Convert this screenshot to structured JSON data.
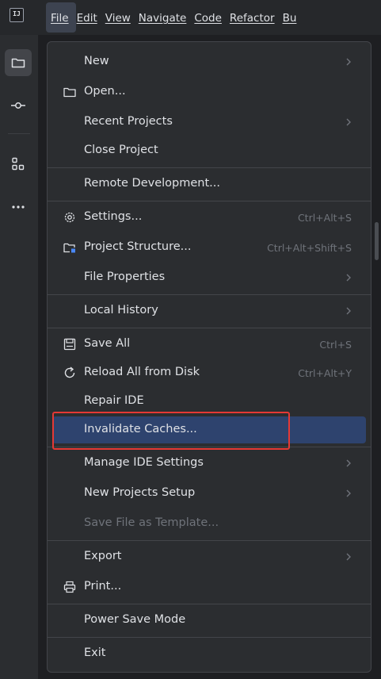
{
  "menubar": {
    "logo": "IJ",
    "items": [
      "File",
      "Edit",
      "View",
      "Navigate",
      "Code",
      "Refactor",
      "Bu"
    ]
  },
  "sidebar_icons": [
    "folder-icon",
    "commit-icon",
    "structure-icon",
    "more-icon"
  ],
  "file_menu": {
    "items": [
      {
        "label": "New",
        "submenu": true
      },
      {
        "label": "Open...",
        "icon": "folder-icon"
      },
      {
        "label": "Recent Projects",
        "submenu": true
      },
      {
        "label": "Close Project"
      },
      {
        "label": "Remote Development..."
      },
      {
        "label": "Settings...",
        "icon": "gear-icon",
        "shortcut": "Ctrl+Alt+S"
      },
      {
        "label": "Project Structure...",
        "icon": "project-structure-icon",
        "shortcut": "Ctrl+Alt+Shift+S"
      },
      {
        "label": "File Properties",
        "submenu": true
      },
      {
        "label": "Local History",
        "submenu": true
      },
      {
        "label": "Save All",
        "icon": "save-icon",
        "shortcut": "Ctrl+S"
      },
      {
        "label": "Reload All from Disk",
        "icon": "reload-icon",
        "shortcut": "Ctrl+Alt+Y"
      },
      {
        "label": "Repair IDE"
      },
      {
        "label": "Invalidate Caches...",
        "selected": true
      },
      {
        "label": "Manage IDE Settings",
        "submenu": true
      },
      {
        "label": "New Projects Setup",
        "submenu": true
      },
      {
        "label": "Save File as Template...",
        "disabled": true
      },
      {
        "label": "Export",
        "submenu": true
      },
      {
        "label": "Print...",
        "icon": "print-icon"
      },
      {
        "label": "Power Save Mode"
      },
      {
        "label": "Exit"
      }
    ]
  },
  "colors": {
    "selection": "#2e436e",
    "highlight_box": "#e53935",
    "menu_bg": "#2b2d30"
  }
}
